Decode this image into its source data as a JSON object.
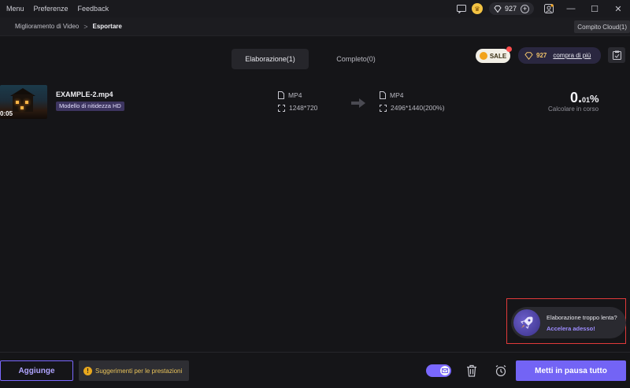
{
  "menu": {
    "items": [
      "Menu",
      "Preferenze",
      "Feedback"
    ]
  },
  "titlebar": {
    "coins": "927"
  },
  "breadcrumb": {
    "parent": "Miglioramento di Video",
    "separator": ">",
    "current": "Esportare"
  },
  "cloud_task": "Compito Cloud(1)",
  "tabs": [
    {
      "label": "Elaborazione(1)",
      "active": true
    },
    {
      "label": "Completo(0)",
      "active": false
    }
  ],
  "promo": {
    "sale_label": "SALE",
    "gem_count": "927",
    "buy_more": "compra di più"
  },
  "task": {
    "file_name": "EXAMPLE-2.mp4",
    "duration": "0:05",
    "model": "Modello di nitidezza HD",
    "source_format": "MP4",
    "source_resolution": "1248*720",
    "target_format": "MP4",
    "target_resolution": "2496*1440(200%)",
    "progress_main": "0.",
    "progress_decimal": "01",
    "progress_unit": "%",
    "status": "Calcolare in corso"
  },
  "speed_tip": {
    "question": "Elaborazione troppo lenta?",
    "link": "Accelera adesso!"
  },
  "bottom": {
    "add_label": "Aggiunge",
    "perf_tips": "Suggerimenti per le prestazioni",
    "pause_all": "Metti in pausa tutto"
  },
  "colors": {
    "accent": "#7364f5",
    "highlight_border": "#e03a3a",
    "warning": "#e8c25a"
  }
}
